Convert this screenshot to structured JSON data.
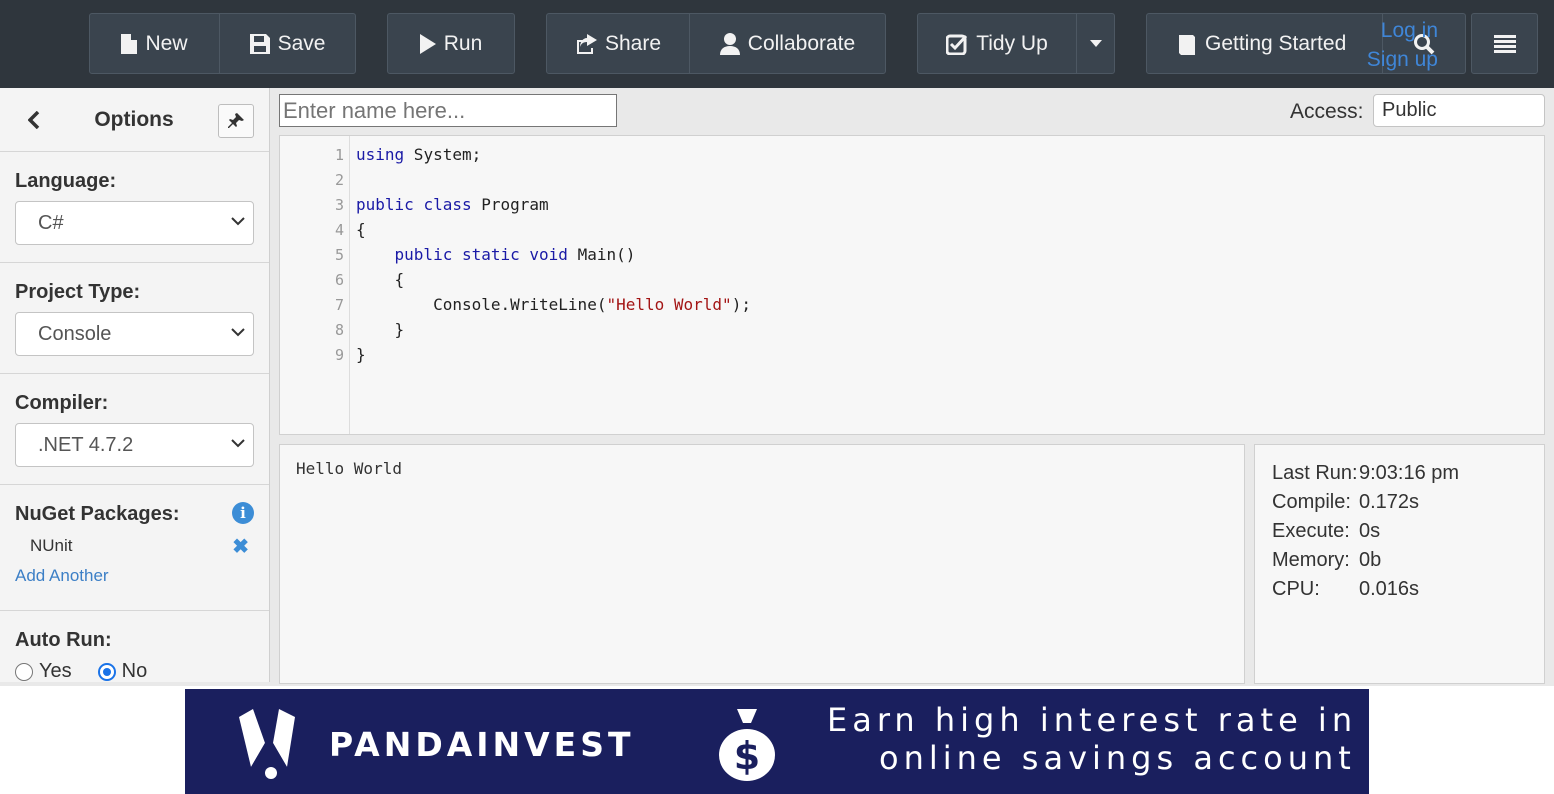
{
  "toolbar": {
    "new_label": "New",
    "save_label": "Save",
    "run_label": "Run",
    "share_label": "Share",
    "collaborate_label": "Collaborate",
    "tidy_label": "Tidy Up",
    "getting_started_label": "Getting Started",
    "login_label": "Log in",
    "signup_label": "Sign up"
  },
  "sidebar": {
    "title": "Options",
    "language": {
      "label": "Language:",
      "value": "C#"
    },
    "project_type": {
      "label": "Project Type:",
      "value": "Console"
    },
    "compiler": {
      "label": "Compiler:",
      "value": ".NET 4.7.2"
    },
    "nuget": {
      "label": "NuGet Packages:",
      "packages": [
        "NUnit"
      ],
      "add_label": "Add Another"
    },
    "auto_run": {
      "label": "Auto Run:",
      "yes_label": "Yes",
      "no_label": "No",
      "selected": "No"
    }
  },
  "main": {
    "name_placeholder": "Enter name here...",
    "access_label": "Access:",
    "access_value": "Public"
  },
  "editor": {
    "line_numbers": [
      "1",
      "2",
      "3",
      "4",
      "5",
      "6",
      "7",
      "8",
      "9"
    ],
    "lines": [
      "using System;",
      "",
      "public class Program",
      "{",
      "    public static void Main()",
      "    {",
      "        Console.WriteLine(\"Hello World\");",
      "    }",
      "}"
    ]
  },
  "output": {
    "text": "Hello World"
  },
  "stats": [
    {
      "key": "Last Run:",
      "value": "9:03:16 pm"
    },
    {
      "key": "Compile:",
      "value": "0.172s"
    },
    {
      "key": "Execute:",
      "value": "0s"
    },
    {
      "key": "Memory:",
      "value": "0b"
    },
    {
      "key": "CPU:",
      "value": "0.016s"
    }
  ],
  "ad": {
    "brand": "PANDAINVEST",
    "line1": "Earn high interest rate in",
    "line2": "online savings account"
  },
  "colors": {
    "toolbar_bg": "#2f363d",
    "accent": "#3c8dd6",
    "ad_bg": "#1a1f5e"
  }
}
